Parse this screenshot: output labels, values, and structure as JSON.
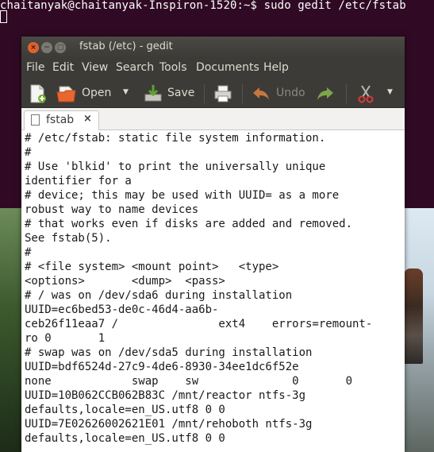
{
  "terminal": {
    "prompt": "chaitanyak@chaitanyak-Inspiron-1520:~$ sudo gedit /etc/fstab"
  },
  "window": {
    "title": "fstab (/etc) - gedit",
    "buttons": {
      "close": "×",
      "minimize": "−",
      "maximize": "□"
    }
  },
  "menu": {
    "items": [
      "File",
      "Edit",
      "View",
      "Search",
      "Tools",
      "Documents",
      "Help"
    ]
  },
  "toolbar": {
    "open_label": "Open",
    "save_label": "Save",
    "undo_label": "Undo"
  },
  "tab": {
    "label": "fstab",
    "close": "×"
  },
  "editor": {
    "lines": [
      "# /etc/fstab: static file system information.",
      "#",
      "# Use 'blkid' to print the universally unique",
      "identifier for a",
      "# device; this may be used with UUID= as a more",
      "robust way to name devices",
      "# that works even if disks are added and removed.",
      "See fstab(5).",
      "#",
      "# <file system> <mount point>   <type>",
      "<options>       <dump>  <pass>",
      "# / was on /dev/sda6 during installation",
      "UUID=ec6bed53-de0c-46d4-aa6b-",
      "ceb26f11eaa7 /               ext4    errors=remount-",
      "ro 0       1",
      "# swap was on /dev/sda5 during installation",
      "UUID=bdf6524d-27c9-4de6-8930-34ee1dc6f52e",
      "none            swap    sw              0       0",
      "UUID=10B062CCB062B83C /mnt/reactor ntfs-3g",
      "defaults,locale=en_US.utf8 0 0",
      "UUID=7E02626002621E01 /mnt/rehoboth ntfs-3g",
      "defaults,locale=en_US.utf8 0 0"
    ]
  },
  "colors": {
    "terminal_bg": "#300a24",
    "titlebar_bg": "#3c3b37",
    "close_button": "#e0622e"
  }
}
